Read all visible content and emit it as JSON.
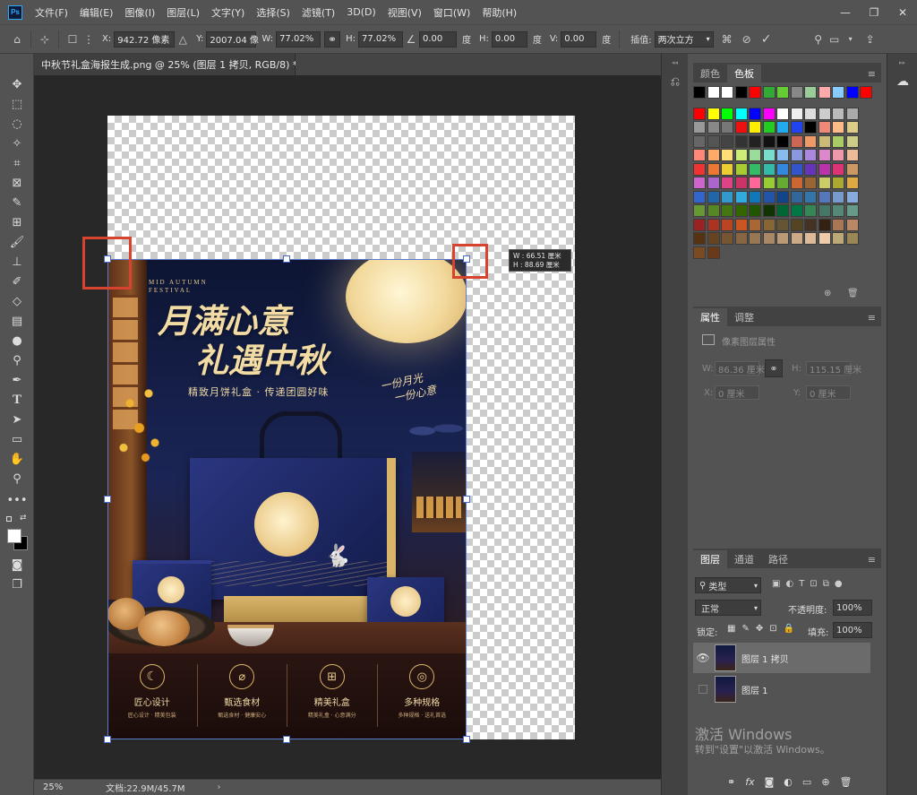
{
  "app": {
    "logo": "Ps"
  },
  "menu": [
    "文件(F)",
    "编辑(E)",
    "图像(I)",
    "图层(L)",
    "文字(Y)",
    "选择(S)",
    "滤镜(T)",
    "3D(D)",
    "视图(V)",
    "窗口(W)",
    "帮助(H)"
  ],
  "window_controls": {
    "minimize": "—",
    "restore": "❐",
    "close": "✕"
  },
  "options": {
    "x_label": "X:",
    "x_value": "942.72 像素",
    "y_label": "Y:",
    "y_value": "2007.04 像",
    "w_label": "W:",
    "w_value": "77.02%",
    "h_label": "H:",
    "h_value": "77.02%",
    "angle_value": "0.00",
    "angle_unit": "度",
    "hskew_label": "H:",
    "hskew_value": "0.00",
    "hskew_unit": "度",
    "vskew_label": "V:",
    "vskew_value": "0.00",
    "vskew_unit": "度",
    "interp_label": "插值:",
    "interp_value": "两次立方"
  },
  "document": {
    "tab_title": "中秋节礼盒海报生成.png @ 25% (图层 1 拷贝, RGB/8) *",
    "close": "×",
    "zoom": "25%",
    "doc_info": "文档:22.9M/45.7M"
  },
  "transform_tooltip": {
    "w": "W :  66.51 厘米",
    "h": "H :  88.69 厘米"
  },
  "poster": {
    "en_line1": "MID AUTUMN",
    "en_line2": "FESTIVAL",
    "headline1": "月满心意",
    "headline2": "礼遇中秋",
    "subtitle": "精致月饼礼盒 · 传递团圆好味",
    "side_line1": "一份月光",
    "side_line2": "一份心意",
    "features": [
      {
        "title": "匠心设计",
        "sub": "匠心设计 · 精美包装",
        "icon": "moon-icon"
      },
      {
        "title": "甄选食材",
        "sub": "甄选食材 · 健康安心",
        "icon": "leaf-icon"
      },
      {
        "title": "精美礼盒",
        "sub": "精美礼盒 · 心意满分",
        "icon": "gift-icon"
      },
      {
        "title": "多种规格",
        "sub": "多种规格 · 送礼首选",
        "icon": "mooncake-icon"
      }
    ]
  },
  "swatches_panel": {
    "tabs": [
      "颜色",
      "色板"
    ],
    "active": "色板"
  },
  "properties_panel": {
    "tabs": [
      "属性",
      "调整"
    ],
    "active": "属性",
    "type": "像素图层属性",
    "w_label": "W:",
    "w_value": "86.36 厘米",
    "h_label": "H:",
    "h_value": "115.15 厘米",
    "x_label": "X:",
    "x_value": "0 厘米",
    "y_label": "Y:",
    "y_value": "0 厘米"
  },
  "layers_panel": {
    "tabs": [
      "图层",
      "通道",
      "路径"
    ],
    "active": "图层",
    "filter_kind": "类型",
    "blend_mode": "正常",
    "opacity_label": "不透明度:",
    "opacity_value": "100%",
    "lock_label": "锁定:",
    "fill_label": "填充:",
    "fill_value": "100%",
    "layers": [
      {
        "name": "图层 1 拷贝",
        "visible": true,
        "selected": true
      },
      {
        "name": "图层 1",
        "visible": false,
        "selected": false
      }
    ]
  },
  "watermark": {
    "line1": "激活 Windows",
    "line2": "转到\"设置\"以激活 Windows。"
  },
  "colors": {
    "accent_red": "#d8432f",
    "canvas_bg": "#282828",
    "ui_bg": "#535353",
    "gold": "#e7c988",
    "navy": "#1f2a66"
  }
}
